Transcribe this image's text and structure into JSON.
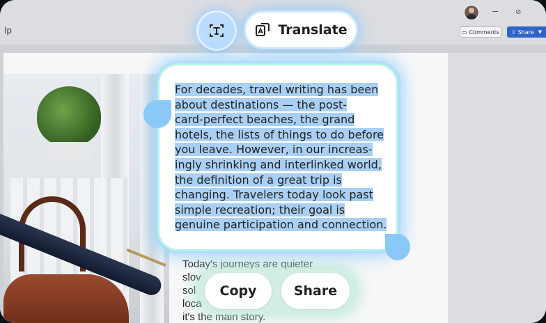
{
  "window": {
    "menu_fragment": "lp",
    "comments_label": "Comments",
    "share_label": "Share"
  },
  "overlay": {
    "translate_label": "Translate",
    "selected_text_lines": [
      "For decades, travel writing has been",
      "about destinations — the post-",
      "card-perfect beaches, the grand",
      "hotels, the lists of things to do before",
      "you leave. However, in our increas-",
      "ingly shrinking and interlinked world,",
      "the definition of a great trip is",
      "changing. Travelers today look past",
      "simple recreation; their goal is",
      "genuine participation and connection."
    ],
    "copy_label": "Copy",
    "share_label": "Share"
  },
  "document": {
    "body_lines": [
      "Today's journeys are quieter",
      "slov",
      "sol",
      "loca",
      "it's the main story."
    ]
  },
  "colors": {
    "selection_highlight": "#a9d0f4",
    "glow": "#8cc8ff",
    "share_blue": "#2f64c8"
  },
  "icons": {
    "ocr": "text-recognition-icon",
    "translate": "translate-icon"
  }
}
